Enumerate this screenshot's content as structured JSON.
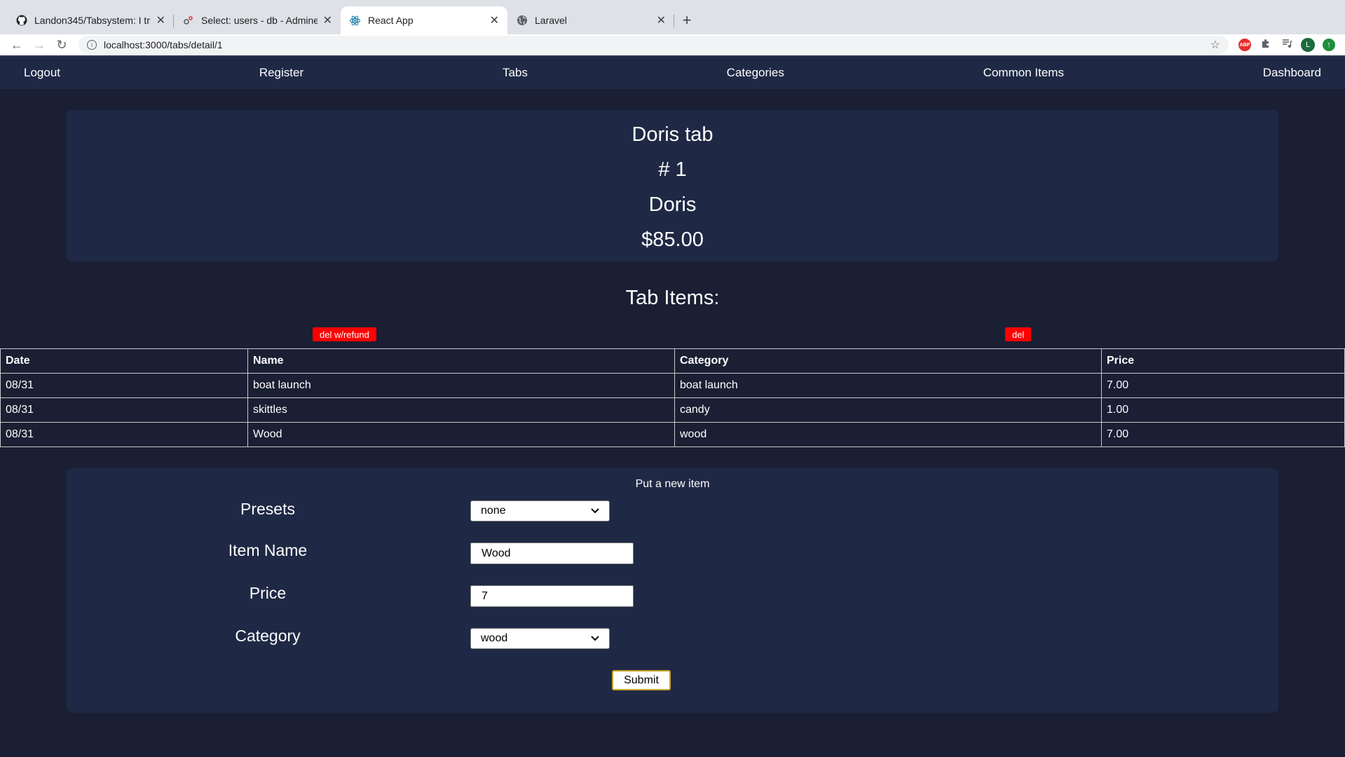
{
  "browser": {
    "tabs": [
      {
        "title": "Landon345/Tabsystem: I tried",
        "icon": "github-icon",
        "active": false
      },
      {
        "title": "Select: users - db - Adminer",
        "icon": "adminer-icon",
        "active": false
      },
      {
        "title": "React App",
        "icon": "react-icon",
        "active": true
      },
      {
        "title": "Laravel",
        "icon": "globe-icon",
        "active": false
      }
    ],
    "url": "localhost:3000/tabs/detail/1",
    "profile_initial": "L",
    "abp_label": "ABP"
  },
  "nav": {
    "logout": "Logout",
    "register": "Register",
    "tabs": "Tabs",
    "categories": "Categories",
    "common_items": "Common Items",
    "dashboard": "Dashboard"
  },
  "tab": {
    "title": "Doris tab",
    "number": "# 1",
    "owner": "Doris",
    "total": "$85.00"
  },
  "items_title": "Tab Items:",
  "actions": {
    "del_refund": "del w/refund",
    "del": "del"
  },
  "table": {
    "headers": [
      "Date",
      "Name",
      "Category",
      "Price"
    ],
    "rows": [
      [
        "08/31",
        "boat launch",
        "boat launch",
        "7.00"
      ],
      [
        "08/31",
        "skittles",
        "candy",
        "1.00"
      ],
      [
        "08/31",
        "Wood",
        "wood",
        "7.00"
      ]
    ]
  },
  "form": {
    "title": "Put a new item",
    "presets_label": "Presets",
    "presets_value": "none",
    "item_name_label": "Item Name",
    "item_name_value": "Wood",
    "price_label": "Price",
    "price_value": "7",
    "category_label": "Category",
    "category_value": "wood",
    "submit": "Submit"
  }
}
